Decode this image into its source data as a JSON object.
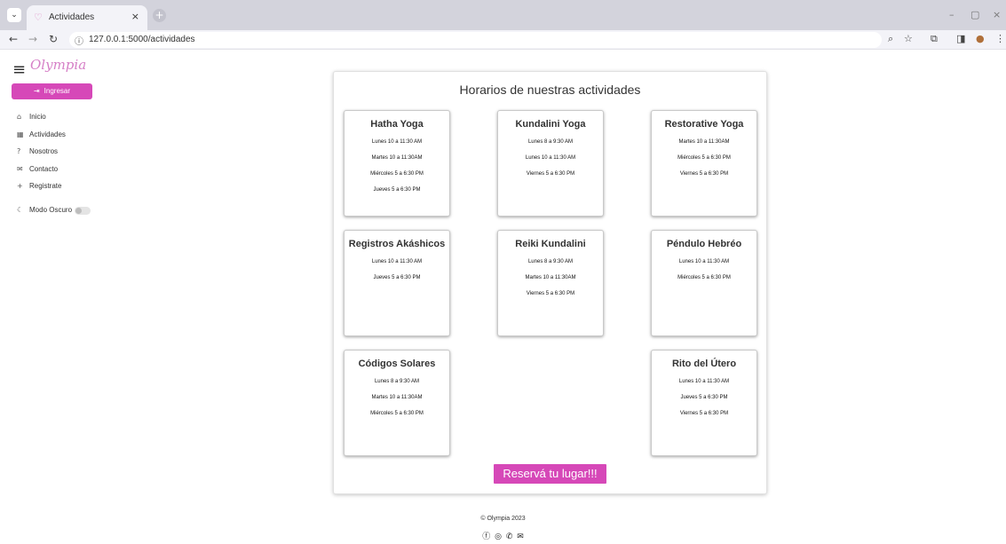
{
  "browser": {
    "tab_title": "Actividades",
    "url": "127.0.0.1:5000/actividades",
    "icons": [
      "tab-list-icon",
      "favicon-icon",
      "close-icon",
      "new-tab-icon",
      "back-icon",
      "forward-icon",
      "reload-icon",
      "site-info-icon",
      "zoom-icon",
      "bookmark-star-icon",
      "extensions-icon",
      "side-panel-icon",
      "profile-icon",
      "more-icon"
    ]
  },
  "sidebar": {
    "logo": "Olympia",
    "login_label": "Ingresar",
    "items": [
      {
        "icon": "home-icon",
        "label": "Inicio"
      },
      {
        "icon": "activities-icon",
        "label": "Actividades"
      },
      {
        "icon": "question-icon",
        "label": "Nosotros"
      },
      {
        "icon": "mail-icon",
        "label": "Contacto"
      },
      {
        "icon": "plus-icon",
        "label": "Registrate"
      }
    ],
    "dark_mode_label": "Modo Oscuro",
    "dark_mode_on": false
  },
  "main": {
    "title": "Horarios de nuestras actividades",
    "cta_label": "Reservá tu lugar!!!",
    "cards": [
      {
        "title": "Hatha Yoga",
        "lines": [
          "Lunes 10 a 11:30 AM",
          "Martes 10 a 11:30AM",
          "Miércoles 5 a 6:30 PM",
          "Jueves 5 a 6:30 PM"
        ]
      },
      {
        "title": "Kundalini Yoga",
        "lines": [
          "Lunes 8 a 9:30 AM",
          "Lunes 10 a 11:30 AM",
          "Viernes 5 a 6:30 PM"
        ]
      },
      {
        "title": "Restorative Yoga",
        "lines": [
          "Martes 10 a 11:30AM",
          "Miércoles 5 a 6:30 PM",
          "Viernes 5 a 6:30 PM"
        ]
      },
      {
        "title": "Registros Akáshicos",
        "lines": [
          "Lunes 10 a 11:30 AM",
          "Jueves 5 a 6:30 PM"
        ]
      },
      {
        "title": "Reiki Kundalini",
        "lines": [
          "Lunes 8 a 9:30 AM",
          "Martes 10 a 11:30AM",
          "Viernes 5 a 6:30 PM"
        ]
      },
      {
        "title": "Péndulo Hebréo",
        "lines": [
          "Lunes 10 a 11:30 AM",
          "Miércoles 5 a 6:30 PM"
        ]
      },
      {
        "title": "Códigos Solares",
        "lines": [
          "Lunes 8 a 9:30 AM",
          "Martes 10 a 11:30AM",
          "Miércoles 5 a 6:30 PM"
        ]
      },
      {
        "title": "Rito del Útero",
        "lines": [
          "Lunes 10 a 11:30 AM",
          "Jueves 5 a 6:30 PM",
          "Viernes 5 a 6:30 PM"
        ]
      }
    ]
  },
  "footer": {
    "copyright": "© Olympia 2023",
    "social_icons": [
      "facebook-icon",
      "instagram-icon",
      "whatsapp-icon",
      "email-icon"
    ]
  },
  "colors": {
    "accent": "#d648b8",
    "logo": "#d680c7"
  }
}
